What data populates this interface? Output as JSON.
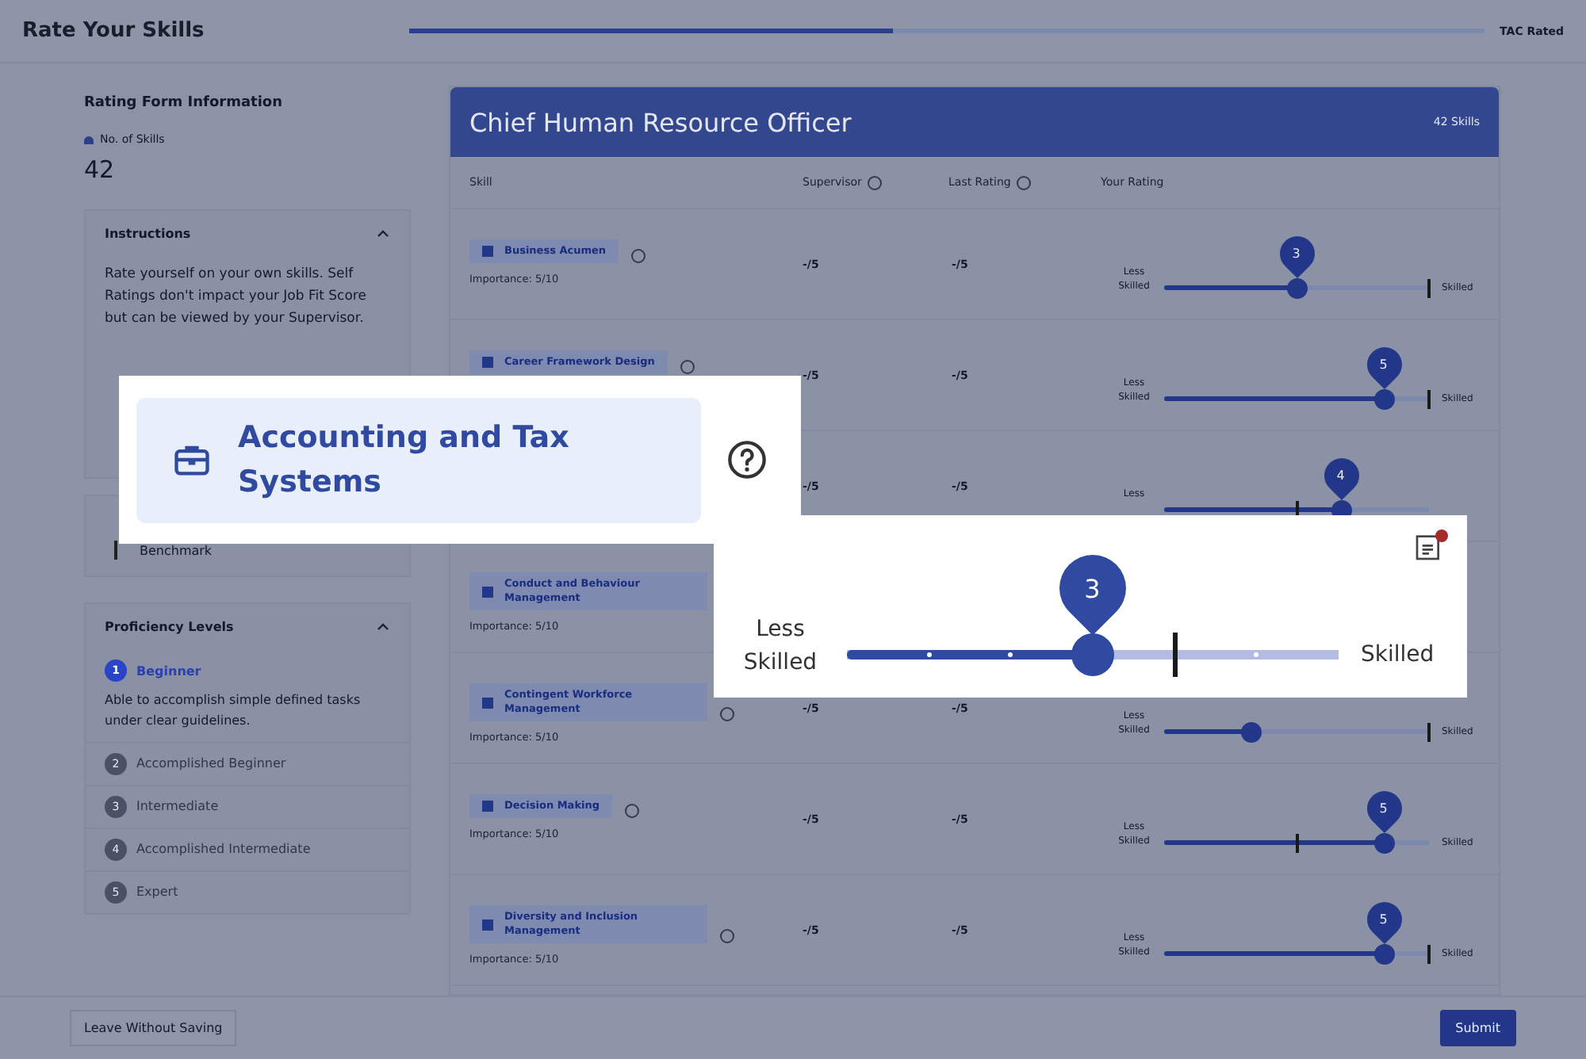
{
  "header": {
    "title": "Rate Your Skills",
    "progress": {
      "level": 0.45
    },
    "status": "TAC Rated"
  },
  "sidebar": {
    "title": "Rating Form Information",
    "stat_label": "No. of Skills",
    "stat_value": "42",
    "instructions": {
      "title": "Instructions",
      "expanded": true,
      "text": "Rate yourself on your own skills. Self Ratings don't impact your Job Fit Score but can be viewed by your Supervisor."
    },
    "legend": {
      "items": [
        "Benchmark"
      ]
    },
    "proficiency": {
      "title": "Proficiency Levels",
      "expanded": true,
      "levels": [
        {
          "number": "1",
          "name": "Beginner",
          "selected": true,
          "description": "Able to accomplish simple defined tasks under clear guidelines."
        },
        {
          "number": "2",
          "name": "Accomplished Beginner",
          "selected": false
        },
        {
          "number": "3",
          "name": "Intermediate",
          "selected": false
        },
        {
          "number": "4",
          "name": "Accomplished Intermediate",
          "selected": false
        },
        {
          "number": "5",
          "name": "Expert",
          "selected": false
        }
      ]
    }
  },
  "card": {
    "title": "Chief Human Resource Officer",
    "count": "42 Skills",
    "columns": [
      "Skill",
      "Supervisor",
      "Last Rating",
      "Your Rating"
    ],
    "rows": [
      {
        "skill": "Business Acumen",
        "help": true,
        "importance": "Importance: 5/10",
        "supervisor": "-/5",
        "last_rating": "-/5",
        "rating": "3",
        "less_label": "Less Skilled",
        "more_label": "Skilled",
        "level": 0.5,
        "benchmark": {
          "level": 1
        }
      },
      {
        "skill": "Career Framework Design",
        "help": true,
        "supervisor": "-/5",
        "last_rating": "-/5",
        "rating": "5",
        "less_label": "Less Skilled",
        "more_label": "Skilled",
        "level": 0.83,
        "benchmark": {
          "level": 1
        }
      },
      {
        "supervisor": "-/5",
        "last_rating": "-/5",
        "rating": "4",
        "less_label": "Less",
        "level": 0.67,
        "benchmark": {
          "level": 0.5
        }
      },
      {
        "skill": "Conduct and Behaviour Management",
        "help": false,
        "importance": "Importance: 5/10"
      },
      {
        "skill": "Contingent Workforce Management",
        "help": true,
        "importance": "Importance: 5/10",
        "supervisor": "-/5",
        "last_rating": "-/5",
        "less_label": "Less Skilled",
        "more_label": "Skilled",
        "level": 0.33,
        "benchmark": {
          "level": 1
        }
      },
      {
        "skill": "Decision Making",
        "help": true,
        "importance": "Importance: 5/10",
        "supervisor": "-/5",
        "last_rating": "-/5",
        "rating": "5",
        "less_label": "Less Skilled",
        "more_label": "Skilled",
        "level": 0.83,
        "benchmark": {
          "level": 0.5
        }
      },
      {
        "skill": "Diversity and Inclusion Management",
        "help": true,
        "importance": "Importance: 5/10",
        "supervisor": "-/5",
        "last_rating": "-/5",
        "rating": "5",
        "less_label": "Less Skilled",
        "more_label": "Skilled",
        "level": 0.83,
        "benchmark": {
          "level": 1
        }
      }
    ]
  },
  "footer": {
    "leave_button": "Leave Without Saving",
    "submit_button": "Submit"
  },
  "callouts": {
    "skill_chip": {
      "name": "Accounting and Tax Systems"
    },
    "slider": {
      "less_label": "Less Skilled",
      "more_label": "Skilled",
      "value": "3",
      "level": 0.5,
      "benchmark": {
        "level": 0.667
      },
      "note_unread": true
    }
  }
}
